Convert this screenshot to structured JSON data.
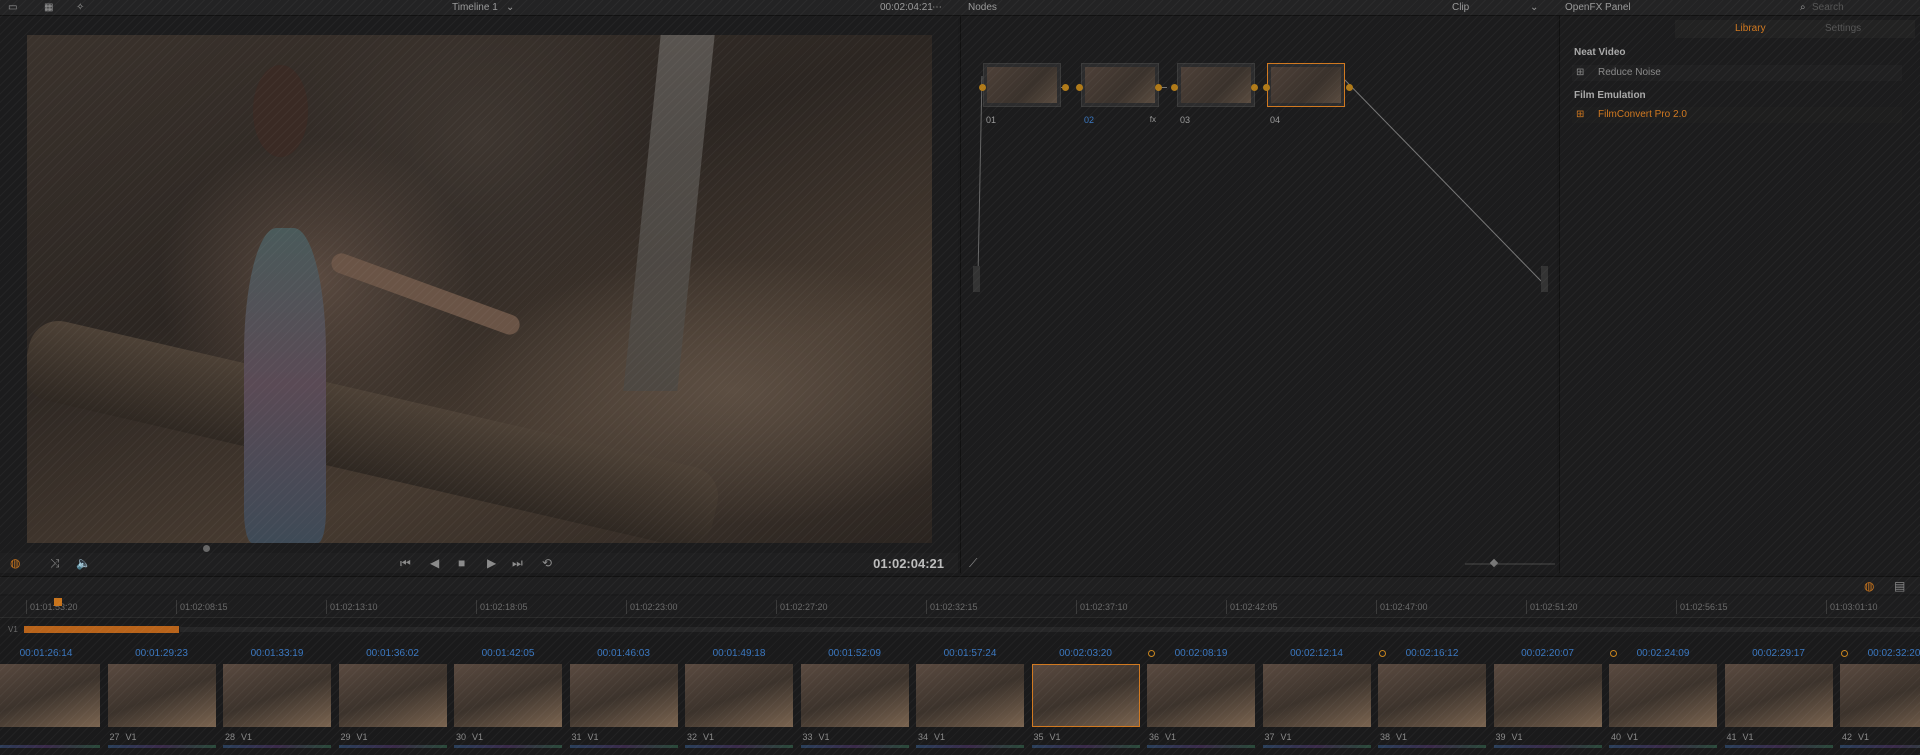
{
  "topbar": {
    "timeline_title": "Timeline 1",
    "viewer_timecode": "00:02:04:21",
    "nodes_title": "Nodes",
    "clip_label": "Clip",
    "ofx_title": "OpenFX Panel",
    "search_placeholder": "Search"
  },
  "viewer": {
    "timecode": "01:02:04:21"
  },
  "nodes": [
    {
      "label": "01",
      "icons": ""
    },
    {
      "label": "02",
      "icons": "fx"
    },
    {
      "label": "03",
      "icons": ""
    },
    {
      "label": "04",
      "icons": ""
    }
  ],
  "ofx": {
    "tabs": [
      "Library",
      "Settings"
    ],
    "group1": "Neat Video",
    "item1": "Reduce Noise",
    "group2": "Film Emulation",
    "item2": "FilmConvert Pro 2.0"
  },
  "ruler": [
    "01:01:53:20",
    "01:02:08:15",
    "01:02:13:10",
    "01:02:18:05",
    "01:02:23:00",
    "01:02:27:20",
    "01:02:32:15",
    "01:02:37:10",
    "01:02:42:05",
    "01:02:47:00",
    "01:02:51:20",
    "01:02:56:15",
    "01:03:01:10"
  ],
  "track": {
    "label": "V1"
  },
  "clips": [
    {
      "tc": "00:01:26:14",
      "num": "",
      "trk": "",
      "mark": false
    },
    {
      "tc": "00:01:29:23",
      "num": "27",
      "trk": "V1",
      "mark": false
    },
    {
      "tc": "00:01:33:19",
      "num": "28",
      "trk": "V1",
      "mark": false
    },
    {
      "tc": "00:01:36:02",
      "num": "29",
      "trk": "V1",
      "mark": false
    },
    {
      "tc": "00:01:42:05",
      "num": "30",
      "trk": "V1",
      "mark": false
    },
    {
      "tc": "00:01:46:03",
      "num": "31",
      "trk": "V1",
      "mark": false
    },
    {
      "tc": "00:01:49:18",
      "num": "32",
      "trk": "V1",
      "mark": false
    },
    {
      "tc": "00:01:52:09",
      "num": "33",
      "trk": "V1",
      "mark": false
    },
    {
      "tc": "00:01:57:24",
      "num": "34",
      "trk": "V1",
      "mark": false
    },
    {
      "tc": "00:02:03:20",
      "num": "35",
      "trk": "V1",
      "mark": true
    },
    {
      "tc": "00:02:08:19",
      "num": "36",
      "trk": "V1",
      "mark": false
    },
    {
      "tc": "00:02:12:14",
      "num": "37",
      "trk": "V1",
      "mark": true
    },
    {
      "tc": "00:02:16:12",
      "num": "38",
      "trk": "V1",
      "mark": false
    },
    {
      "tc": "00:02:20:07",
      "num": "39",
      "trk": "V1",
      "mark": true
    },
    {
      "tc": "00:02:24:09",
      "num": "40",
      "trk": "V1",
      "mark": false
    },
    {
      "tc": "00:02:29:17",
      "num": "41",
      "trk": "V1",
      "mark": true
    },
    {
      "tc": "00:02:32:20",
      "num": "42",
      "trk": "V1",
      "mark": false
    }
  ],
  "colors": {
    "accent": "#d0781f",
    "timecode_blue": "#3a77c0"
  }
}
